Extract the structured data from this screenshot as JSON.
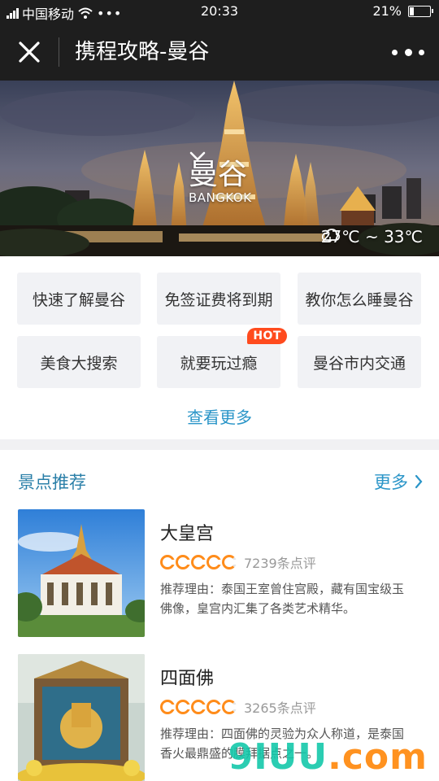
{
  "status_bar": {
    "carrier": "中国移动",
    "time": "20:33",
    "battery": "21%",
    "battery_level": 0.21
  },
  "nav": {
    "title": "携程攻略-曼谷",
    "close_icon": "close-icon",
    "more_icon": "more-dots-icon"
  },
  "hero": {
    "city": "曼谷",
    "city_en": "BANGKOK",
    "weather": "27℃ ~ 33℃",
    "weather_icon": "cloud-icon"
  },
  "tags": [
    {
      "label": "快速了解曼谷"
    },
    {
      "label": "免签证费将到期"
    },
    {
      "label": "教你怎么睡曼谷"
    },
    {
      "label": "美食大搜索"
    },
    {
      "label": "就要玩过瘾",
      "badge": "HOT"
    },
    {
      "label": "曼谷市内交通"
    }
  ],
  "see_more": "查看更多",
  "section": {
    "title": "景点推荐",
    "more": "更多"
  },
  "attractions": [
    {
      "name": "大皇宫",
      "rating": 4.5,
      "reviews": "7239条点评",
      "reason": "推荐理由：泰国王室曾住宫殿，藏有国宝级玉佛像，皇宫内汇集了各类艺术精华。"
    },
    {
      "name": "四面佛",
      "rating": 4.5,
      "reviews": "3265条点评",
      "reason": "推荐理由：四面佛的灵验为众人称道，是泰国香火最鼎盛的膜拜据点之一。"
    }
  ],
  "colors": {
    "accent": "#2a95c8",
    "rating": "#ff8c1a",
    "hot": "#ff4b1e",
    "dark_bar": "#1e1e1e"
  },
  "watermark": {
    "brand": "9IUU",
    "suffix": ".com"
  }
}
